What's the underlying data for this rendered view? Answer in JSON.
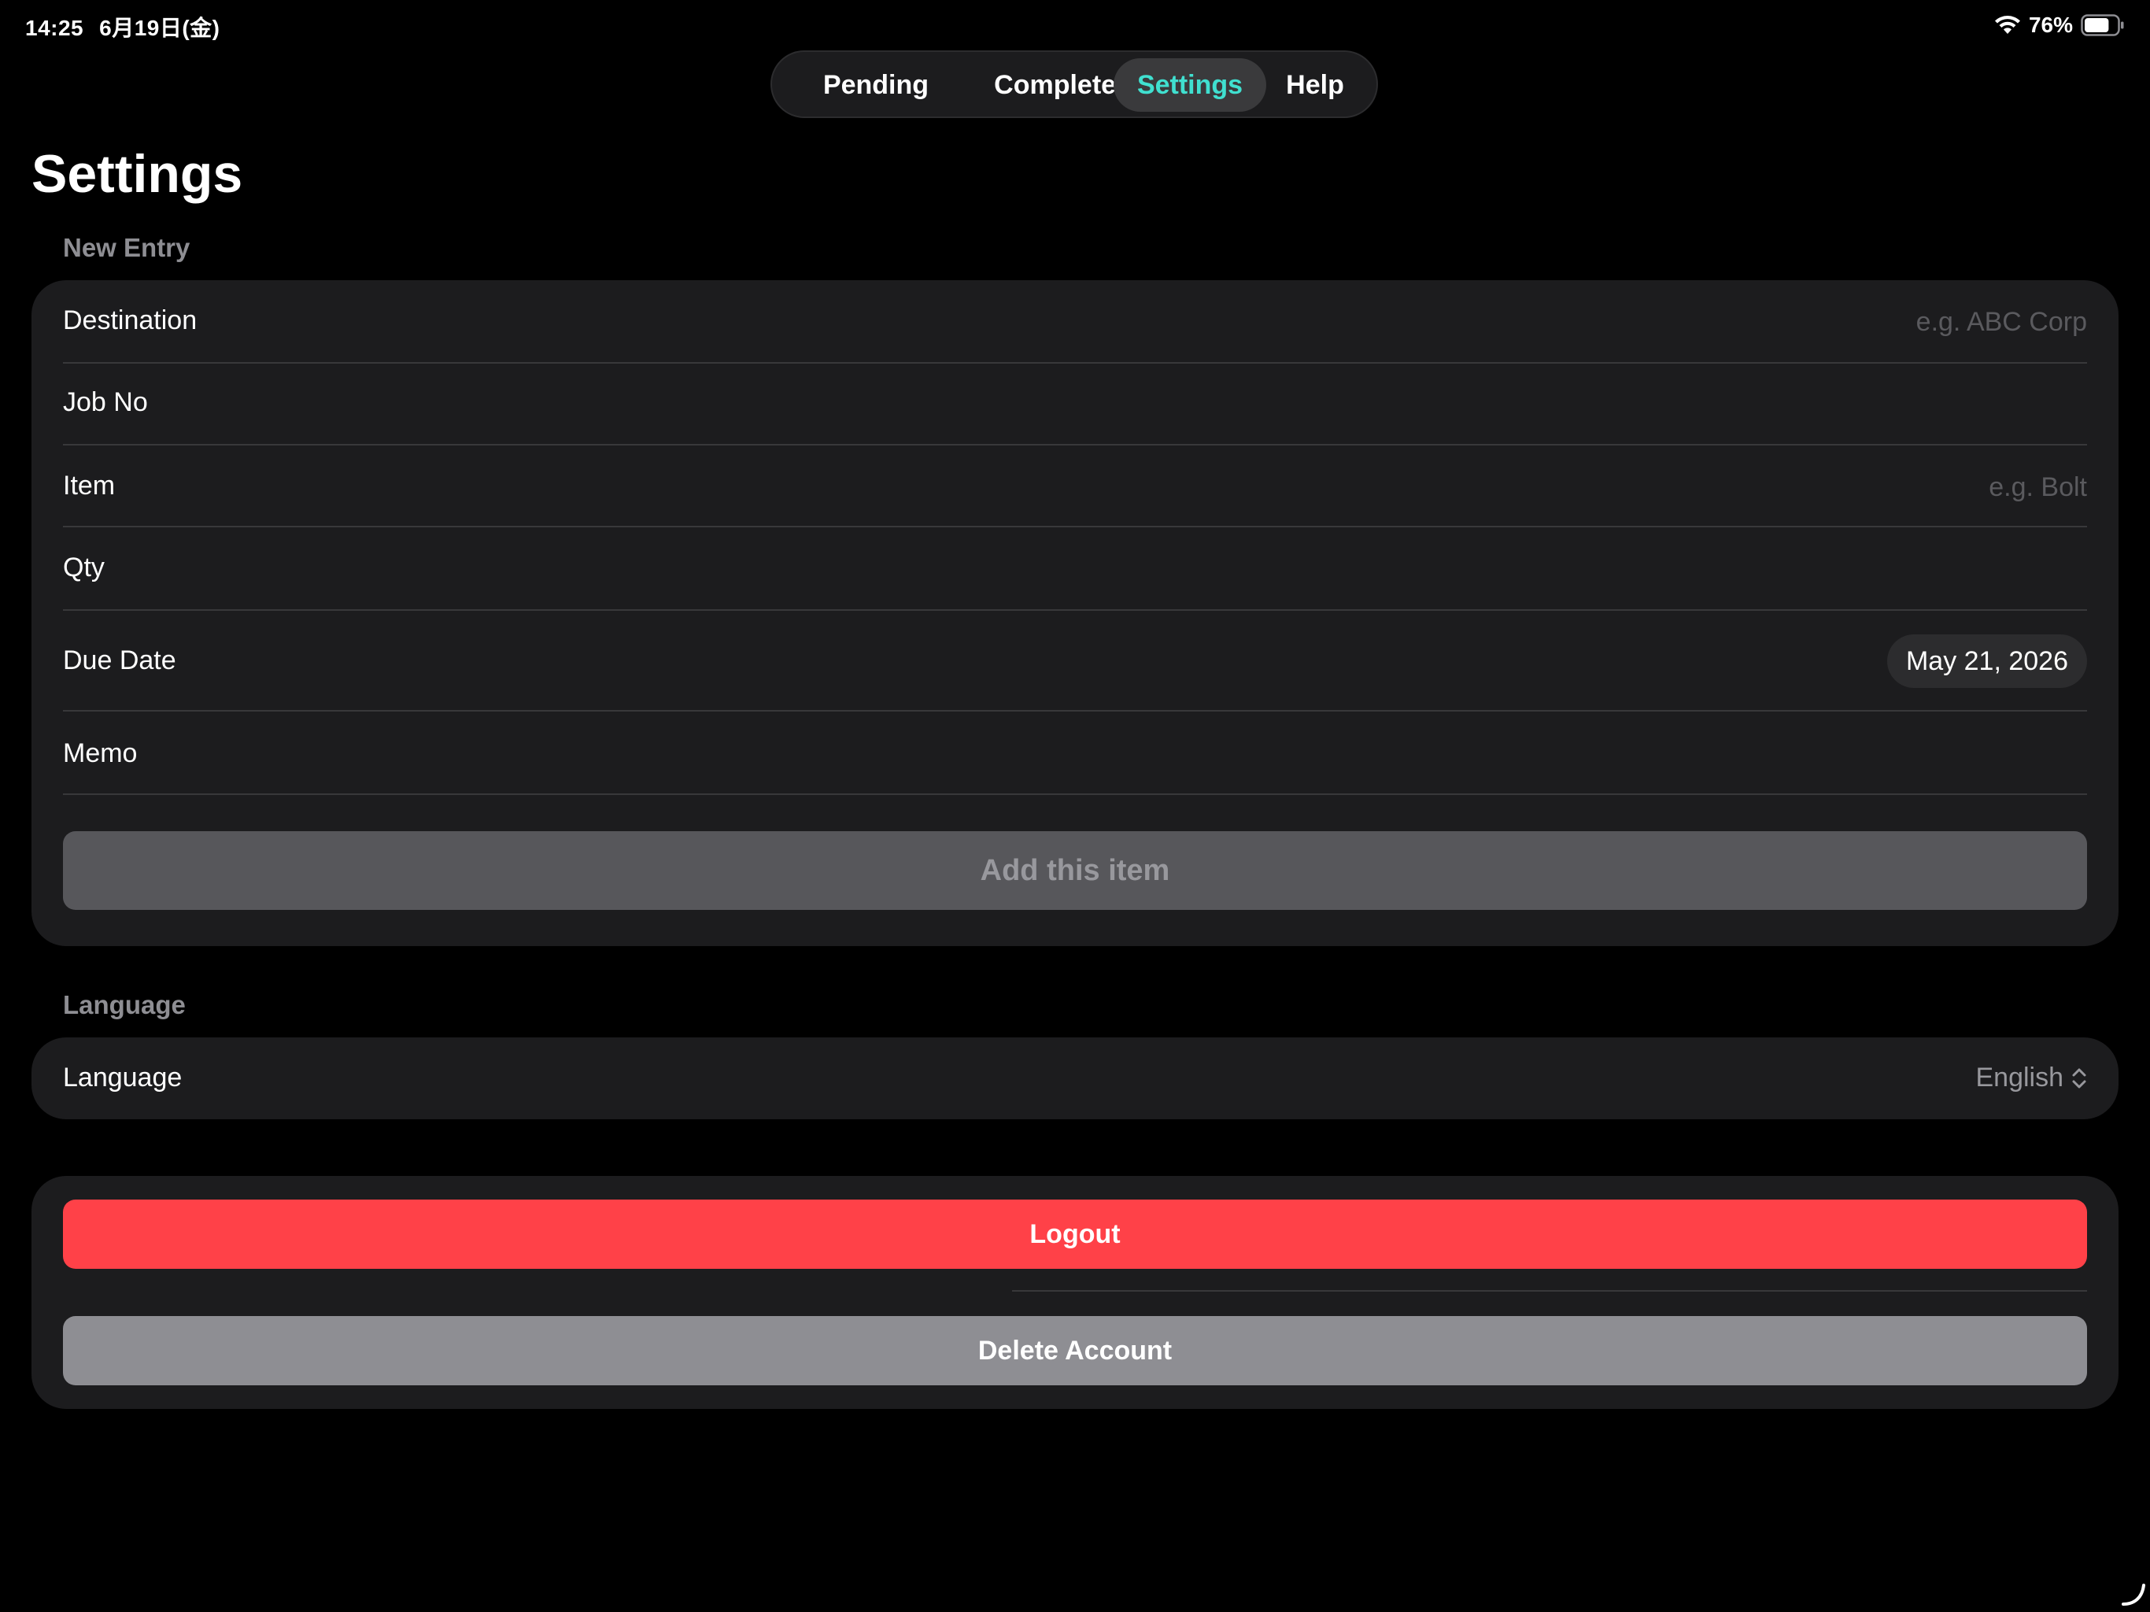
{
  "status_bar": {
    "time": "14:25",
    "date": "6月19日(金)",
    "battery_percent": "76%",
    "battery_level": 0.76
  },
  "tabs": [
    {
      "label": "Pending",
      "active": false
    },
    {
      "label": "Completed",
      "active": false
    },
    {
      "label": "Settings",
      "active": true
    },
    {
      "label": "Help",
      "active": false
    }
  ],
  "page_title": "Settings",
  "new_entry": {
    "header": "New Entry",
    "fields": [
      {
        "label": "Destination",
        "value": "",
        "placeholder": "e.g. ABC Corp"
      },
      {
        "label": "Job No",
        "value": "",
        "placeholder": ""
      },
      {
        "label": "Item",
        "value": "",
        "placeholder": "e.g. Bolt"
      },
      {
        "label": "Qty",
        "value": "",
        "placeholder": ""
      },
      {
        "label": "Due Date",
        "value": "May 21, 2026"
      },
      {
        "label": "Memo",
        "value": "",
        "placeholder": ""
      }
    ],
    "add_button_label": "Add this item"
  },
  "language_section": {
    "header": "Language",
    "row_label": "Language",
    "selected_value": "English"
  },
  "account": {
    "logout_label": "Logout",
    "delete_label": "Delete Account"
  },
  "colors": {
    "accent": "#40e0d0",
    "destructive": "#ff4148",
    "card_background": "#1c1c1e"
  }
}
